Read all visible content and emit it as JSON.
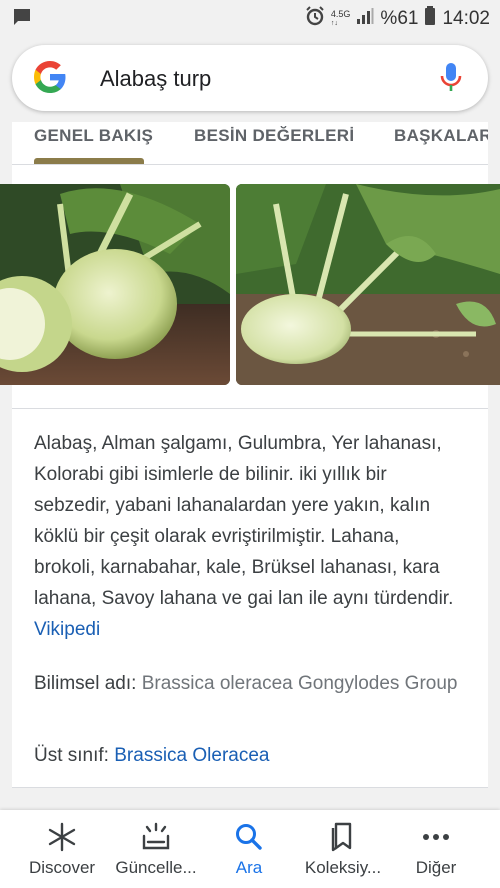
{
  "status_bar": {
    "network_top": "4.5G",
    "network_bottom": "↑↓",
    "battery": "%61",
    "time": "14:02",
    "icons": [
      "message-icon",
      "alarm-icon",
      "signal-icon",
      "battery-icon"
    ]
  },
  "search": {
    "query": "Alabaş turp",
    "icons": [
      "google-logo-icon",
      "mic-icon"
    ]
  },
  "tabs": [
    {
      "label": "GENEL BAKIŞ",
      "active": true
    },
    {
      "label": "BESİN DEĞERLERİ",
      "active": false
    },
    {
      "label": "BAŞKALAR",
      "active": false
    }
  ],
  "description": {
    "text": "Alabaş, Alman şalgamı, Gulumbra, Yer lahanası, Kolorabi gibi isimlerle de bilinir. iki yıllık bir sebzedir, yabani lahanalardan yere yakın, kalın köklü bir çeşit olarak evriştirilmiştir. Lahana, brokoli, karnabahar, kale, Brüksel lahanası, kara lahana, Savoy lahana ve gai lan ile aynı türdendir.",
    "source_link": "Vikipedi"
  },
  "attributes": {
    "scientific_name_label": "Bilimsel adı:",
    "scientific_name_value": "Brassica oleracea Gongylodes Group",
    "class_label": "Üst sınıf:",
    "class_value": "Brassica Oleracea"
  },
  "bottom_nav": [
    {
      "label": "Discover",
      "icon": "asterisk-icon",
      "active": false
    },
    {
      "label": "Güncelle...",
      "icon": "updates-icon",
      "active": false
    },
    {
      "label": "Ara",
      "icon": "search-icon",
      "active": true
    },
    {
      "label": "Koleksiy...",
      "icon": "collections-icon",
      "active": false
    },
    {
      "label": "Diğer",
      "icon": "more-icon",
      "active": false
    }
  ],
  "colors": {
    "accent_blue": "#1a73e8",
    "link_blue": "#1a5fb4",
    "tab_underline": "#8b7c4a"
  }
}
